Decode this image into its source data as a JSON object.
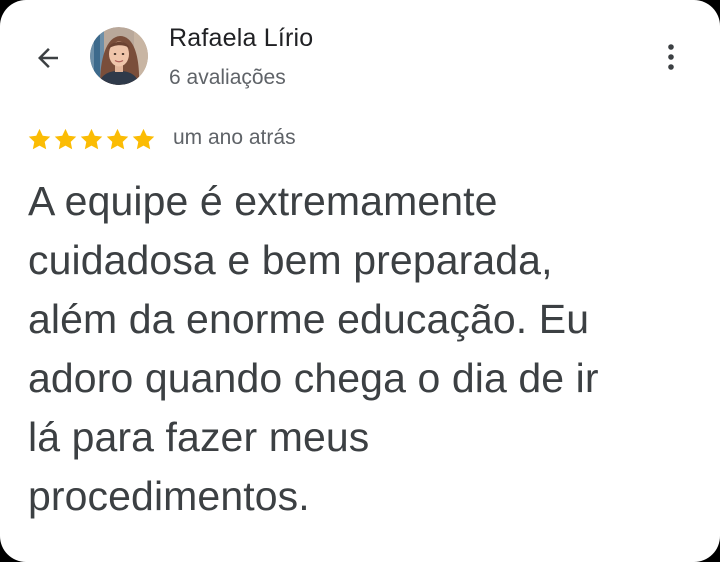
{
  "header": {
    "back_icon": "arrow-left-icon",
    "more_icon": "more-vertical-icon",
    "reviewer": {
      "name": "Rafaela Lírio",
      "review_count": "6 avaliações",
      "avatar": "profile-photo"
    }
  },
  "review": {
    "rating": 5,
    "max_rating": 5,
    "star_color": "#fbbc04",
    "date": "um ano atrás",
    "text_lines": [
      "A equipe é extremamente",
      "cuidadosa e bem preparada,",
      "além da enorme educação. Eu",
      "adoro quando chega o dia de ir",
      "lá para fazer meus",
      "procedimentos."
    ]
  }
}
